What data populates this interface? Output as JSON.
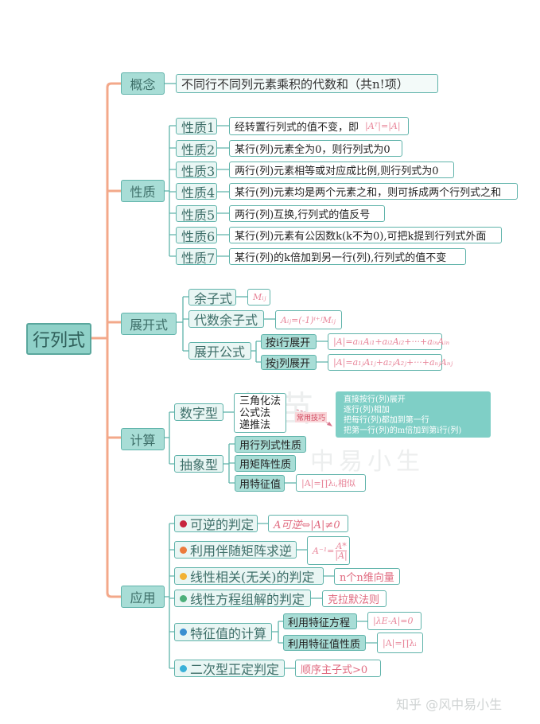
{
  "root": {
    "label": "行列式"
  },
  "colors": {
    "trunk": "#f3a88a",
    "branch": "#5fb3aa",
    "formula": "#e8869a",
    "badge1": "#c7253e",
    "badge2": "#ec7a3c",
    "badge3": "#f2b233",
    "badge4": "#4caf7a",
    "badge5": "#3a8fd0",
    "badge6": "#3ab0d8"
  },
  "concept": {
    "label": "概念",
    "definition": "不同行不同列元素乘积的代数和（共n!项）"
  },
  "properties": {
    "label": "性质",
    "items": [
      {
        "label": "性质1",
        "text": "经转置行列式的值不变，即",
        "formula": "|Aᵀ|=|A|"
      },
      {
        "label": "性质2",
        "text": "某行(列)元素全为0，则行列式为0"
      },
      {
        "label": "性质3",
        "text": "两行(列)元素相等或对应成比例,则行列式为0"
      },
      {
        "label": "性质4",
        "text": "某行(列)元素均是两个元素之和，则可拆成两个行列式之和"
      },
      {
        "label": "性质5",
        "text": "两行(列)互换,行列式的值反号"
      },
      {
        "label": "性质6",
        "text": "某行(列)元素有公因数k(k不为0),可把k提到行列式外面"
      },
      {
        "label": "性质7",
        "text": "某行(列)的k倍加到另一行(列),行列式的值不变"
      }
    ]
  },
  "expansion": {
    "label": "展开式",
    "minor": {
      "label": "余子式",
      "formula": "Mᵢⱼ"
    },
    "cofactor": {
      "label": "代数余子式",
      "formula": "Aᵢⱼ=(-1)ⁱ⁺ʲMᵢⱼ"
    },
    "formula": {
      "label": "展开公式",
      "by_row": {
        "label": "按i行展开",
        "formula": "|A|=aᵢ₁Aᵢ₁+aᵢ₂Aᵢ₂+···+aᵢₙAᵢₙ"
      },
      "by_col": {
        "label": "按j列展开",
        "formula": "|A|=a₁ⱼA₁ⱼ+a₂ⱼA₂ⱼ+···+aₙⱼAₙⱼ"
      }
    }
  },
  "computation": {
    "label": "计算",
    "numeric": {
      "label": "数字型",
      "methods": "三角化法\n公式法\n递推法",
      "tag": "常用技巧",
      "tips": "直接按行(列)展开\n逐行(列)相加\n把每行(列)都加到第一行\n把第一行(列)的m倍加到第i行(列)"
    },
    "abstract": {
      "label": "抽象型",
      "items": [
        {
          "label": "用行列式性质"
        },
        {
          "label": "用矩阵性质"
        },
        {
          "label": "用特征值",
          "formula": "|A|=∏λᵢ,相似"
        }
      ]
    }
  },
  "application": {
    "label": "应用",
    "items": [
      {
        "num": "1",
        "label": "可逆的判定",
        "formula": "A可逆⇔|A|≠0"
      },
      {
        "num": "2",
        "label": "利用伴随矩阵求逆",
        "formula_num": "A*",
        "formula_den": "|A|",
        "formula_lhs": "A⁻¹="
      },
      {
        "num": "3",
        "label": "线性相关(无关)的判定",
        "formula": "n个n维向量"
      },
      {
        "num": "4",
        "label": "线性方程组解的判定",
        "formula": "克拉默法则"
      },
      {
        "num": "5",
        "label": "特征值的计算",
        "sub": [
          {
            "label": "利用特征方程",
            "formula": "|λE-A|=0"
          },
          {
            "label": "利用特征值性质",
            "formula": "|A|=∏λᵢ"
          }
        ]
      },
      {
        "num": "6",
        "label": "二次型正定判定",
        "formula": "顺序主子式>0"
      }
    ]
  },
  "watermark": {
    "text": "知乎 @风中易小生",
    "bg_text1": "将苗",
    "bg_text2": "中易小生"
  }
}
